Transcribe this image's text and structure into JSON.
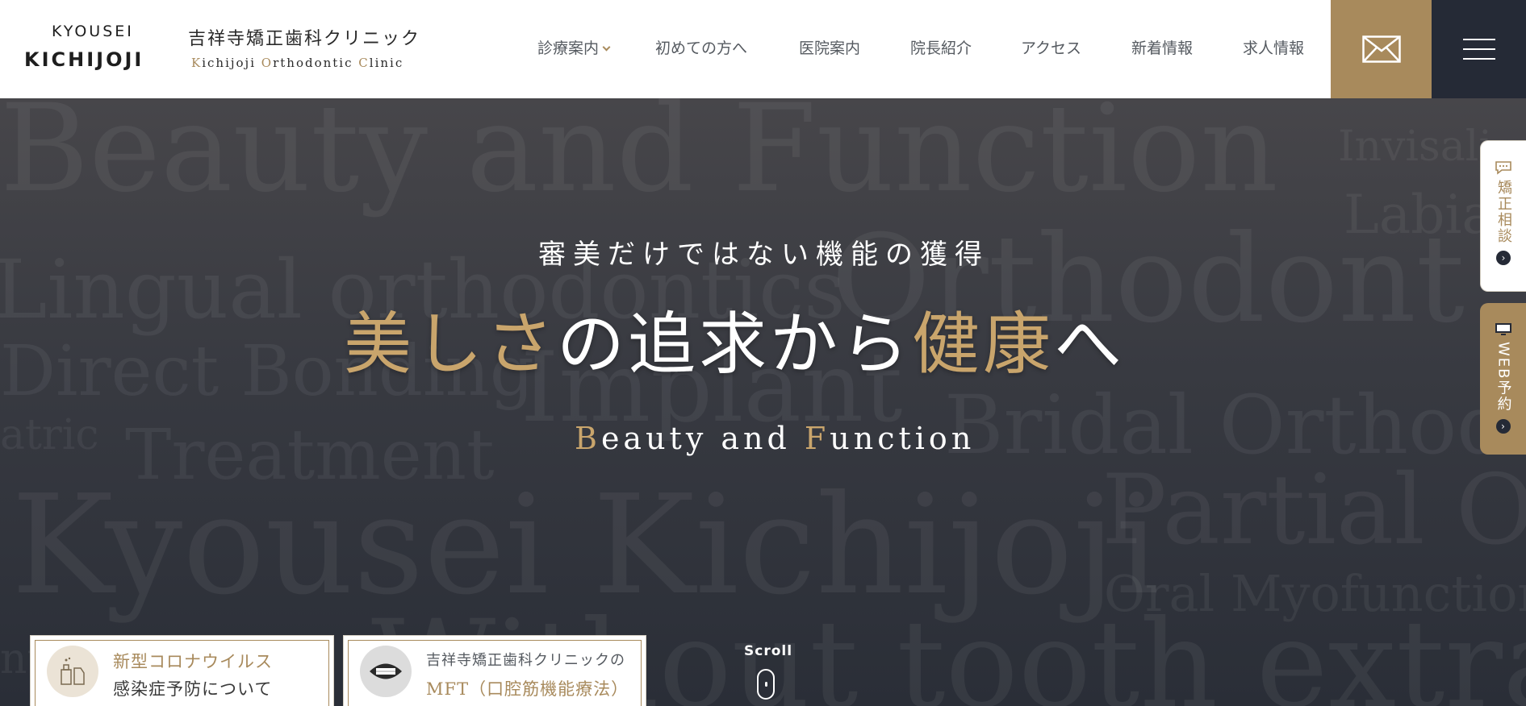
{
  "header": {
    "logo_top": "KYOUSEI",
    "logo_bottom": "KICHIJOJI",
    "clinic_name_jp": "吉祥寺矯正歯科クリニック",
    "clinic_name_en": [
      {
        "text": "K",
        "accent": true
      },
      {
        "text": "ichijoji ",
        "accent": false
      },
      {
        "text": "O",
        "accent": true
      },
      {
        "text": "rthodontic ",
        "accent": false
      },
      {
        "text": "C",
        "accent": true
      },
      {
        "text": "linic",
        "accent": false
      }
    ],
    "nav": [
      {
        "label": "診療案内",
        "has_dropdown": true
      },
      {
        "label": "初めての方へ"
      },
      {
        "label": "医院案内"
      },
      {
        "label": "院長紹介"
      },
      {
        "label": "アクセス"
      },
      {
        "label": "新着情報"
      },
      {
        "label": "求人情報"
      }
    ],
    "mail_icon": "envelope-icon",
    "menu_icon": "hamburger-icon"
  },
  "hero": {
    "background_words": [
      "Beauty and Function",
      "Invisali",
      "Labia",
      "Lingual orthodontics",
      "Orthodont",
      "Direct Bonding",
      "Implant",
      "atric",
      "Treatment",
      "Bridal Orthodo",
      "Kyousei Kichijoji",
      "Partial Or",
      "Oral Myofunction",
      "nt",
      "Without tooth extractio"
    ],
    "tagline": "審美だけではない機能の獲得",
    "headline": [
      {
        "text": "美しさ",
        "accent": true
      },
      {
        "text": "の追求から",
        "accent": false
      },
      {
        "text": "健康",
        "accent": true
      },
      {
        "text": "へ",
        "accent": false
      }
    ],
    "subtitle_en": [
      {
        "text": "B",
        "accent": true
      },
      {
        "text": "eauty and ",
        "accent": false
      },
      {
        "text": "F",
        "accent": true
      },
      {
        "text": "unction",
        "accent": false
      }
    ]
  },
  "side_tabs": {
    "consult": {
      "label": "矯正相談",
      "icon": "chat-bubble-icon"
    },
    "web": {
      "label": "WEB予約",
      "icon": "monitor-icon"
    }
  },
  "cards": [
    {
      "line1": "新型コロナウイルス",
      "line2": "感染症予防について",
      "icon": "disinfectant-icon"
    },
    {
      "line1": "吉祥寺矯正歯科クリニックの",
      "line2": "MFT（口腔筋機能療法）",
      "icon": "mouth-icon"
    }
  ],
  "scroll_label": "Scroll",
  "colors": {
    "accent": "#a88a5c",
    "gold_text": "#c9a56c",
    "dark": "#252a36",
    "header_bg": "#ffffff"
  }
}
